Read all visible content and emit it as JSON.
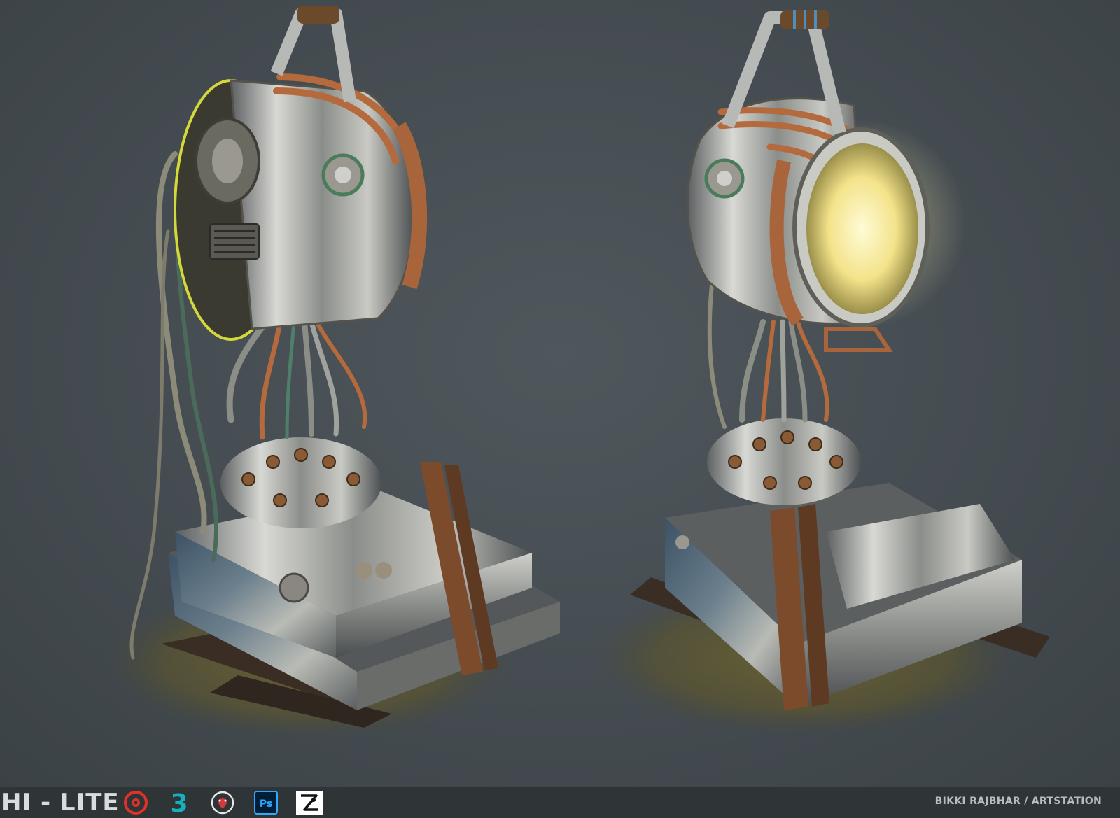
{
  "footer": {
    "brand": "HI - LITE",
    "credit": "BIKKI RAJBHAR / ARTSTATION",
    "tools": [
      {
        "icon": "substance-painter-icon",
        "color": "#e0322a"
      },
      {
        "icon": "3ds-max-icon",
        "color": "#16b1bd",
        "glyph": "3"
      },
      {
        "icon": "marmoset-toolbag-icon",
        "color": "#e8e8e8"
      },
      {
        "icon": "photoshop-icon",
        "color": "#31a8ff",
        "glyph": "Ps"
      },
      {
        "icon": "zbrush-icon",
        "color": "#ffffff"
      }
    ]
  },
  "colors": {
    "background": "#434a4f",
    "footer_bg": "#2f3437",
    "lamp_glow": "#fff6b0",
    "copper": "#b46a3c",
    "steel": "#b7b9b6"
  }
}
